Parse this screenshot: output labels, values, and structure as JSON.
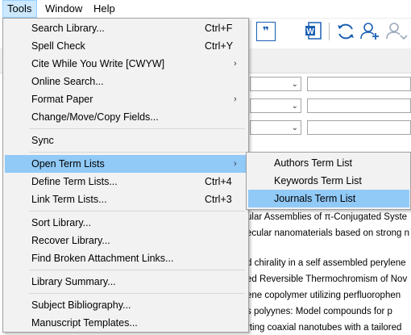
{
  "menubar": {
    "items": [
      {
        "label": "Tools"
      },
      {
        "label": "Window"
      },
      {
        "label": "Help"
      }
    ]
  },
  "tools_menu": {
    "items": [
      {
        "label": "Search Library...",
        "shortcut": "Ctrl+F"
      },
      {
        "label": "Spell Check",
        "shortcut": "Ctrl+Y"
      },
      {
        "label": "Cite While You Write [CWYW]",
        "submenu": true
      },
      {
        "label": "Online Search..."
      },
      {
        "label": "Format Paper",
        "submenu": true
      },
      {
        "label": "Change/Move/Copy Fields..."
      },
      {
        "label": "Sync"
      },
      {
        "label": "Open Term Lists",
        "submenu": true,
        "highlighted": true
      },
      {
        "label": "Define Term Lists...",
        "shortcut": "Ctrl+4"
      },
      {
        "label": "Link Term Lists...",
        "shortcut": "Ctrl+3"
      },
      {
        "label": "Sort Library..."
      },
      {
        "label": "Recover Library..."
      },
      {
        "label": "Find Broken Attachment Links..."
      },
      {
        "label": "Library Summary..."
      },
      {
        "label": "Subject Bibliography..."
      },
      {
        "label": "Manuscript Templates..."
      }
    ],
    "submenu_arrow": "›"
  },
  "term_lists_submenu": {
    "items": [
      {
        "label": "Authors Term List"
      },
      {
        "label": "Keywords Term List"
      },
      {
        "label": "Journals Term List",
        "highlighted": true
      }
    ]
  },
  "references": {
    "rows": [
      "ular Assemblies of π-Conjugated Syste",
      "ecular nanomaterials based on strong n",
      "d chirality in a self assembled perylene",
      "ed Reversible Thermochromism of Nov",
      "ene copolymer utilizing perfluorophen",
      "s polyynes: Model compounds for p",
      "rting coaxial nanotubes with a tailored"
    ]
  },
  "toolbar": {
    "icons": [
      "quote-icon",
      "word-document-icon",
      "sync-icon",
      "add-user-icon",
      "share-user-icon"
    ],
    "quote_glyph": "❞",
    "word_glyph": "W"
  },
  "search_panel": {
    "dropdown_chevron": "⌄"
  },
  "colors": {
    "menu_bg": "#f2f2f2",
    "highlight": "#91c9f7",
    "menubar_active": "#cce8ff",
    "icon_blue": "#1b5fb3"
  }
}
